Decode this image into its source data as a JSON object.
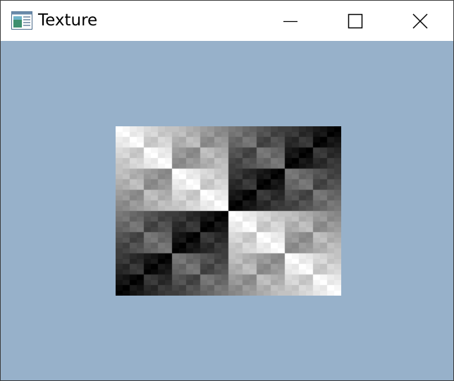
{
  "window": {
    "title": "Texture",
    "client_background": "#97b1ca"
  },
  "titlebar": {
    "app_icon": "window-app-icon",
    "controls": [
      {
        "name": "minimize",
        "icon": "minimize-icon"
      },
      {
        "name": "maximize",
        "icon": "maximize-icon"
      },
      {
        "name": "close",
        "icon": "close-icon"
      }
    ]
  },
  "texture": {
    "description_kind": "grayscale fractal checkerboard texture",
    "colors": [
      "#000000",
      "#ffffff"
    ]
  }
}
